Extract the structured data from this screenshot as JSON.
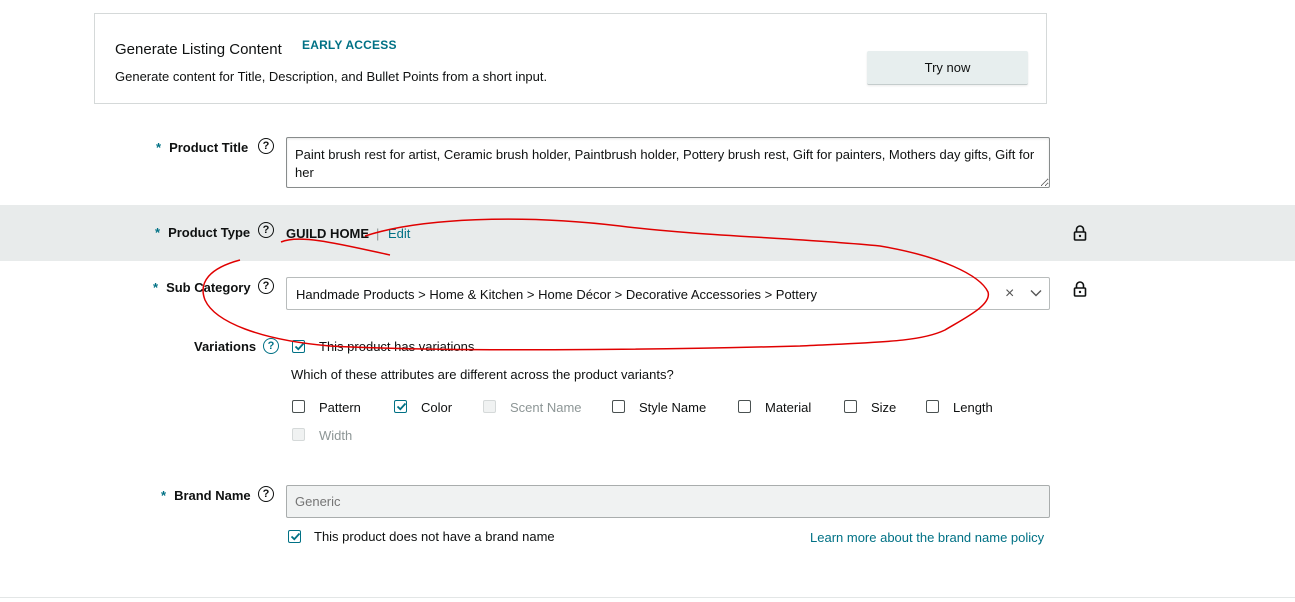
{
  "card": {
    "title": "Generate Listing Content",
    "badge": "EARLY ACCESS",
    "description": "Generate content for Title, Description, and Bullet Points from a short input.",
    "button": "Try now"
  },
  "fields": {
    "required_mark": "*",
    "help_glyph": "?",
    "product_title": {
      "label": "Product Title",
      "value": "Paint brush rest for artist, Ceramic brush holder, Paintbrush holder, Pottery brush rest, Gift for painters, Mothers day gifts, Gift for her"
    },
    "product_type": {
      "label": "Product Type",
      "value": "GUILD HOME",
      "separator": "|",
      "edit": "Edit"
    },
    "sub_category": {
      "label": "Sub Category",
      "value": "Handmade Products > Home & Kitchen > Home Décor > Decorative Accessories > Pottery",
      "clear_glyph": "×"
    },
    "variations": {
      "label": "Variations",
      "has_variations": "This product has variations",
      "question": "Which of these attributes are different across the product variants?",
      "options": [
        {
          "label": "Pattern",
          "state": "unchecked"
        },
        {
          "label": "Color",
          "state": "checked"
        },
        {
          "label": "Scent Name",
          "state": "disabled"
        },
        {
          "label": "Style Name",
          "state": "unchecked"
        },
        {
          "label": "Material",
          "state": "unchecked"
        },
        {
          "label": "Size",
          "state": "unchecked"
        },
        {
          "label": "Length",
          "state": "unchecked"
        },
        {
          "label": "Width",
          "state": "disabled"
        }
      ]
    },
    "brand_name": {
      "label": "Brand Name",
      "placeholder": "Generic",
      "no_brand": "This product does not have a brand name",
      "learn_more": "Learn more about the brand name policy"
    }
  },
  "icons": {
    "help": "question-circle-icon",
    "lock": "lock-icon",
    "check": "checkmark-icon",
    "chevron": "chevron-down-icon"
  },
  "colors": {
    "accent": "#007185",
    "annotation": "#e00000",
    "band": "#e8ebeb"
  }
}
